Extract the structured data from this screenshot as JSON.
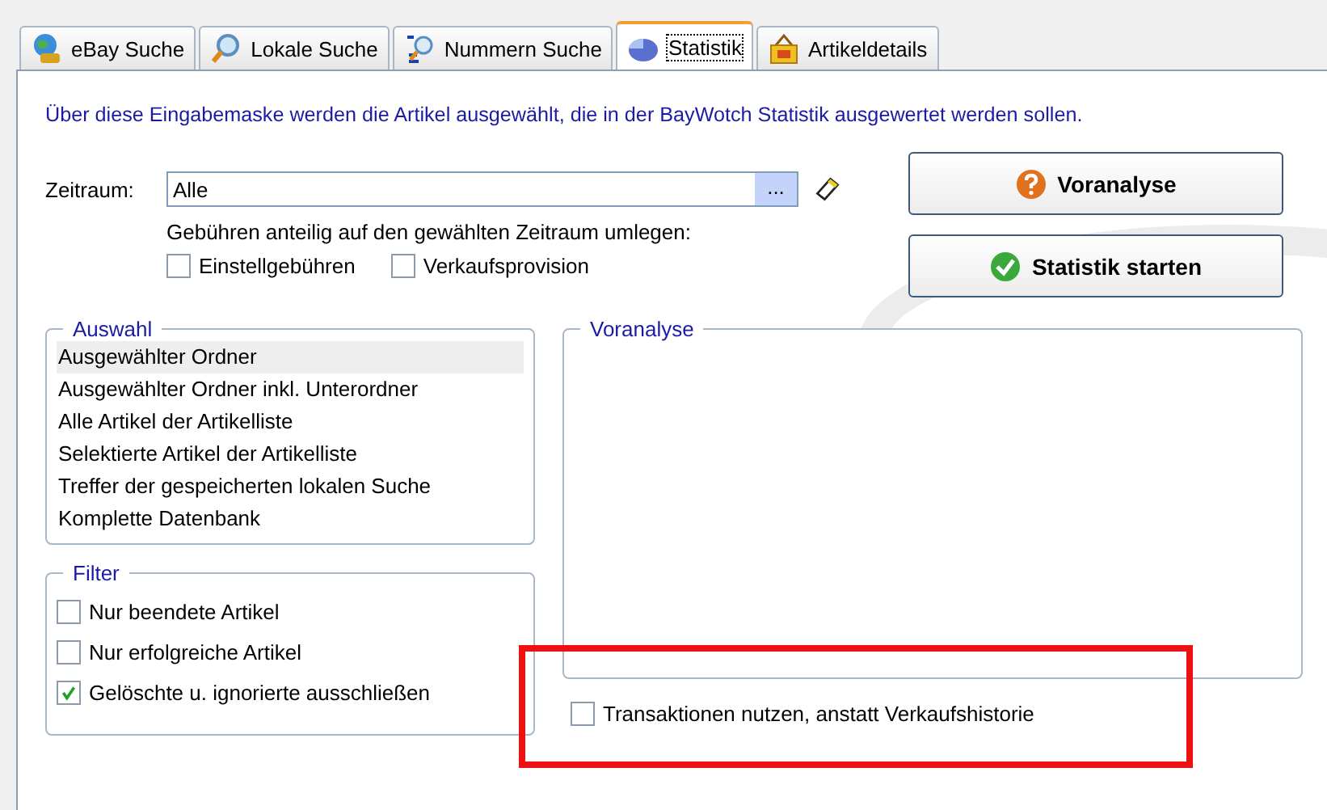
{
  "tabs": [
    {
      "label": "eBay Suche",
      "kind": "globe",
      "selected": false
    },
    {
      "label": "Lokale Suche",
      "kind": "magnifier",
      "selected": false
    },
    {
      "label": "Nummern Suche",
      "kind": "numbers",
      "selected": false
    },
    {
      "label": "Statistik",
      "kind": "pie",
      "selected": true
    },
    {
      "label": "Artikeldetails",
      "kind": "bag",
      "selected": false
    }
  ],
  "intro": "Über diese Eingabemaske werden die Artikel ausgewählt, die in der BayWotch Statistik ausgewertet werden sollen.",
  "period": {
    "label": "Zeitraum:",
    "value": "Alle",
    "browse": "..."
  },
  "fees": {
    "label": "Gebühren anteilig auf den gewählten Zeitraum umlegen:",
    "options": [
      {
        "label": "Einstellgebühren",
        "checked": false
      },
      {
        "label": "Verkaufsprovision",
        "checked": false
      }
    ]
  },
  "buttons": [
    {
      "label": "Voranalyse",
      "kind": "help"
    },
    {
      "label": "Statistik starten",
      "kind": "confirm"
    }
  ],
  "selection": {
    "title": "Auswahl",
    "items": [
      {
        "label": "Ausgewählter Ordner",
        "selected": true
      },
      {
        "label": "Ausgewählter Ordner inkl. Unterordner",
        "selected": false
      },
      {
        "label": "Alle Artikel der Artikelliste",
        "selected": false
      },
      {
        "label": "Selektierte Artikel der Artikelliste",
        "selected": false
      },
      {
        "label": "Treffer der gespeicherten lokalen Suche",
        "selected": false
      },
      {
        "label": "Komplette Datenbank",
        "selected": false
      }
    ]
  },
  "filter": {
    "title": "Filter",
    "options": [
      {
        "label": "Nur beendete Artikel",
        "checked": false
      },
      {
        "label": "Nur erfolgreiche Artikel",
        "checked": false
      },
      {
        "label": "Gelöschte u. ignorierte ausschließen",
        "checked": true
      }
    ]
  },
  "preanalysis": {
    "title": "Voranalyse"
  },
  "transactions": {
    "label": "Transaktionen nutzen, anstatt Verkaufshistorie",
    "checked": false,
    "highlighted": true
  }
}
